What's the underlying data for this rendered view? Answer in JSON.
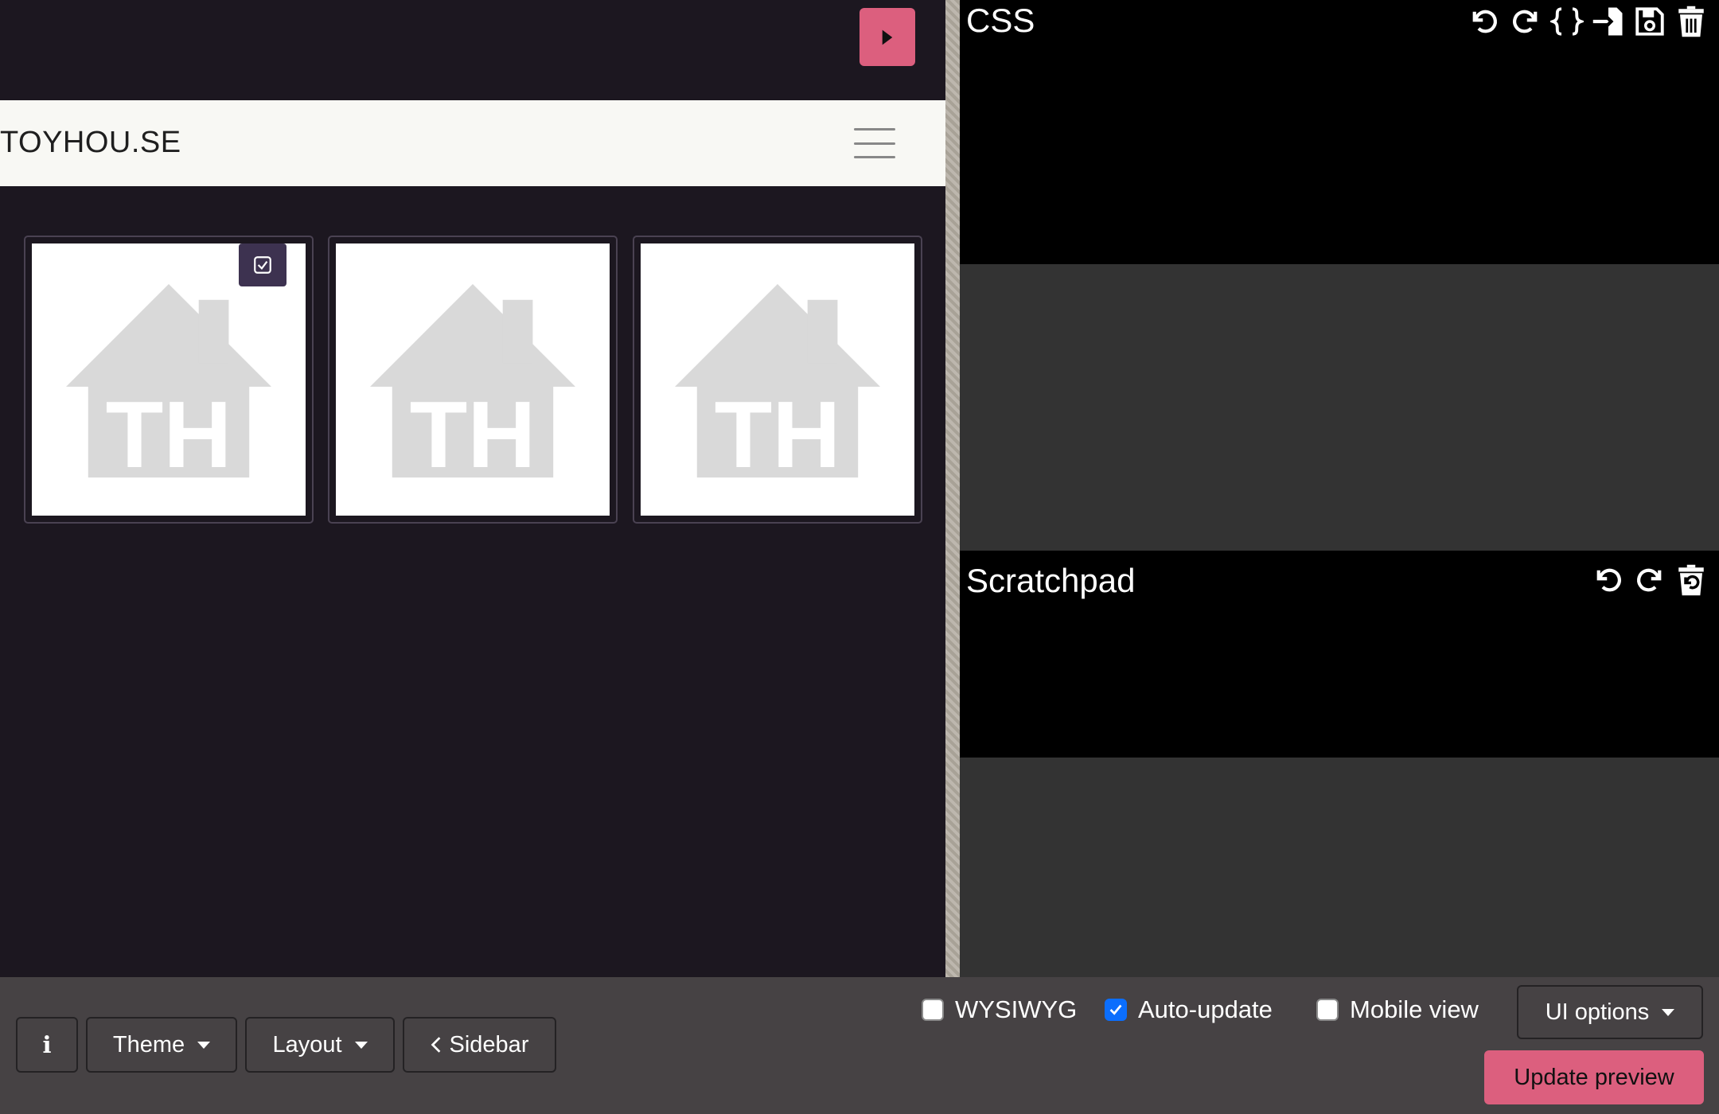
{
  "preview": {
    "site_brand": "TOYHOU.SE",
    "thumbnails": [
      {
        "placeholder_text": "TH"
      },
      {
        "placeholder_text": "TH"
      },
      {
        "placeholder_text": "TH"
      }
    ]
  },
  "editors": {
    "css": {
      "title": "CSS",
      "tools": [
        "undo-icon",
        "redo-icon",
        "format-braces-icon",
        "import-icon",
        "save-icon",
        "trash-icon"
      ]
    },
    "scratchpad": {
      "title": "Scratchpad",
      "tools": [
        "undo-icon",
        "redo-icon",
        "trash-restore-icon"
      ]
    }
  },
  "bottom_bar": {
    "info_label": "i",
    "theme_label": "Theme",
    "layout_label": "Layout",
    "sidebar_label": "Sidebar",
    "wysiwyg_label": "WYSIWYG",
    "wysiwyg_checked": false,
    "auto_update_label": "Auto-update",
    "auto_update_checked": true,
    "mobile_view_label": "Mobile view",
    "mobile_view_checked": false,
    "ui_options_label": "UI options",
    "update_preview_label": "Update preview"
  },
  "colors": {
    "accent_pink": "#dc5f7e",
    "preview_bg": "#1c1720",
    "editor_bg": "#000000",
    "pane_bg": "#333333",
    "bottom_bar_bg": "#464244",
    "checkbox_blue": "#0b6efd"
  }
}
